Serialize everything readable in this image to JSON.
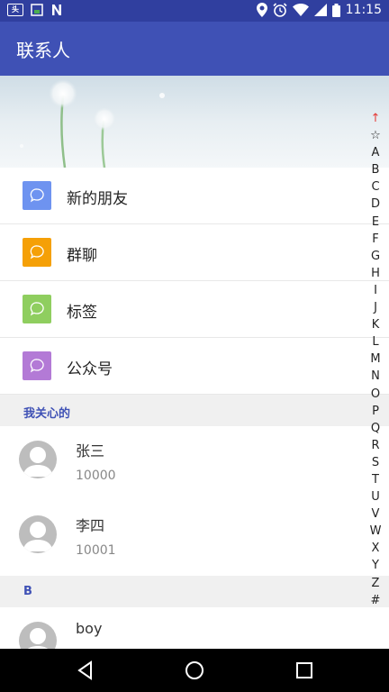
{
  "status_bar": {
    "time": "11:15",
    "left_icons": [
      "news-icon",
      "image-icon",
      "n-icon"
    ],
    "right_icons": [
      "location-icon",
      "alarm-icon",
      "wifi-icon",
      "signal-icon",
      "battery-icon"
    ]
  },
  "app_bar": {
    "title": "联系人",
    "color": "#3f51b5"
  },
  "function_items": [
    {
      "label": "新的朋友",
      "color": "#6e93f0",
      "icon": "chat-icon"
    },
    {
      "label": "群聊",
      "color": "#f5a007",
      "icon": "chat-icon"
    },
    {
      "label": "标签",
      "color": "#8fce5f",
      "icon": "chat-icon"
    },
    {
      "label": "公众号",
      "color": "#b37ad6",
      "icon": "chat-icon"
    }
  ],
  "sections": [
    {
      "header": "我关心的",
      "contacts": [
        {
          "name": "张三",
          "number": "10000"
        },
        {
          "name": "李四",
          "number": "10001"
        }
      ]
    },
    {
      "header": "B",
      "contacts": [
        {
          "name": "boy",
          "number": ""
        }
      ]
    }
  ],
  "index_letters": [
    "↑",
    "☆",
    "A",
    "B",
    "C",
    "D",
    "E",
    "F",
    "G",
    "H",
    "I",
    "J",
    "K",
    "L",
    "M",
    "N",
    "O",
    "P",
    "Q",
    "R",
    "S",
    "T",
    "U",
    "V",
    "W",
    "X",
    "Y",
    "Z",
    "#"
  ]
}
